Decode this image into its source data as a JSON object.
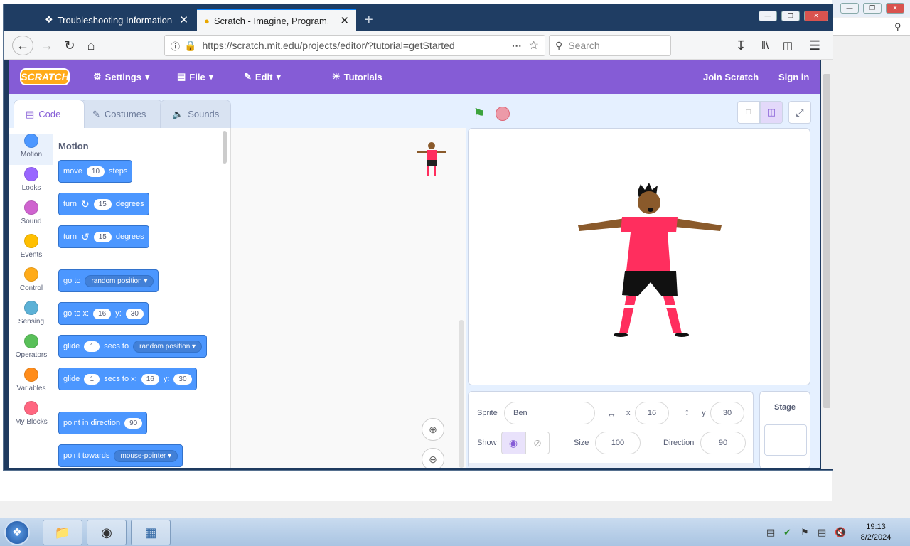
{
  "browser": {
    "tabs": [
      {
        "label": "Troubleshooting Information"
      },
      {
        "label": "Scratch - Imagine, Program, Sh"
      }
    ],
    "url": "https://scratch.mit.edu/projects/editor/?tutorial=getStarted",
    "search_placeholder": "Search"
  },
  "scratch": {
    "logo": "SCRATCH",
    "menu": {
      "settings": "Settings",
      "file": "File",
      "edit": "Edit",
      "tutorials": "Tutorials",
      "join": "Join Scratch",
      "signin": "Sign in"
    },
    "editor_tabs": {
      "code": "Code",
      "costumes": "Costumes",
      "sounds": "Sounds"
    },
    "categories": [
      {
        "label": "Motion",
        "color": "#4c97ff"
      },
      {
        "label": "Looks",
        "color": "#9966ff"
      },
      {
        "label": "Sound",
        "color": "#cf63cf"
      },
      {
        "label": "Events",
        "color": "#ffbf00"
      },
      {
        "label": "Control",
        "color": "#ffab19"
      },
      {
        "label": "Sensing",
        "color": "#5cb1d6"
      },
      {
        "label": "Operators",
        "color": "#59c059"
      },
      {
        "label": "Variables",
        "color": "#ff8c1a"
      },
      {
        "label": "My Blocks",
        "color": "#ff6680"
      }
    ],
    "palette": {
      "heading": "Motion",
      "move": {
        "a": "move",
        "n": "10",
        "b": "steps"
      },
      "turn_cw": {
        "a": "turn",
        "n": "15",
        "b": "degrees"
      },
      "turn_ccw": {
        "a": "turn",
        "n": "15",
        "b": "degrees"
      },
      "goto": {
        "a": "go to",
        "dd": "random position"
      },
      "gotoxy": {
        "a": "go to x:",
        "x": "16",
        "b": "y:",
        "y": "30"
      },
      "glide": {
        "a": "glide",
        "n": "1",
        "b": "secs to",
        "dd": "random position"
      },
      "glidexy": {
        "a": "glide",
        "n": "1",
        "b": "secs to x:",
        "x": "16",
        "c": "y:",
        "y": "30"
      },
      "point": {
        "a": "point in direction",
        "n": "90"
      },
      "towards": {
        "a": "point towards",
        "dd": "mouse-pointer"
      }
    },
    "sprite_info": {
      "sprite_label": "Sprite",
      "sprite_name": "Ben",
      "x_label": "x",
      "x": "16",
      "y_label": "y",
      "y": "30",
      "show_label": "Show",
      "size_label": "Size",
      "size": "100",
      "direction_label": "Direction",
      "direction": "90"
    },
    "stage_label": "Stage"
  },
  "taskbar": {
    "time": "19:13",
    "date": "8/2/2024"
  }
}
